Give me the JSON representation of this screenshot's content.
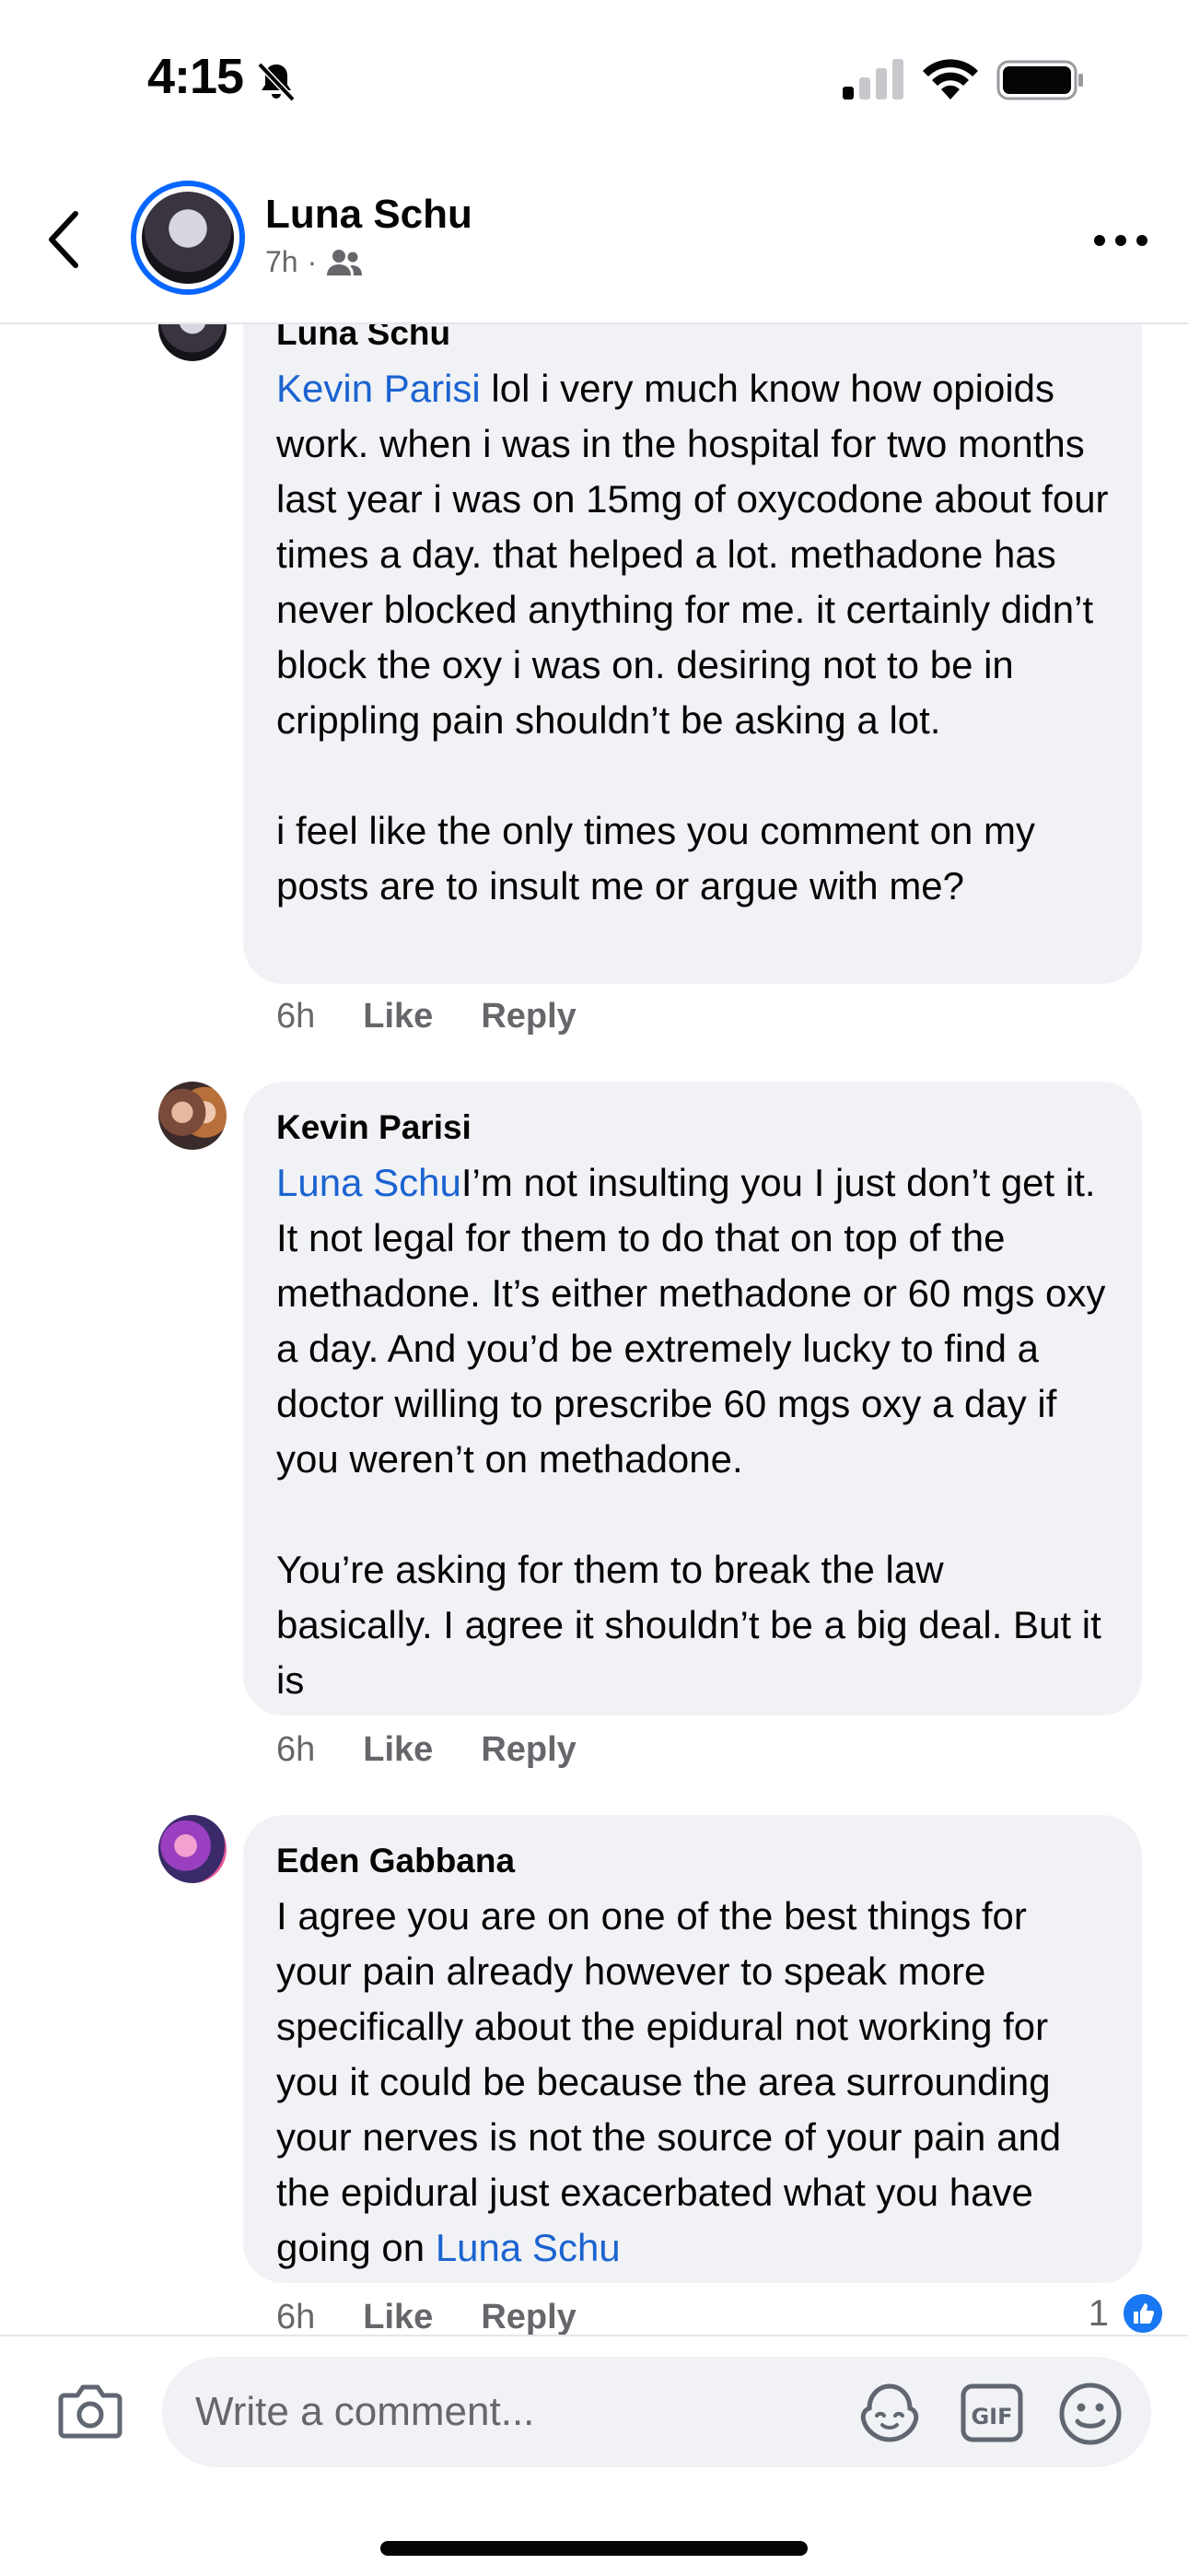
{
  "status_bar": {
    "time": "4:15"
  },
  "header": {
    "name": "Luna Schu",
    "time": "7h",
    "separator": "·"
  },
  "comments": [
    {
      "author": "Luna Schu",
      "mention": "Kevin Parisi",
      "text_after_mention": " lol i very much know how opioids work. when i was in the hospital for two months last year i was on 15mg of oxycodone about four times a day. that helped a lot. methadone has never blocked anything for me. it certainly didn’t block the oxy i was on. desiring not to be in crippling pain shouldn’t be asking a lot.\n\ni feel like the only times you comment on my posts are to insult me or argue with me?",
      "time": "6h",
      "like_label": "Like",
      "reply_label": "Reply"
    },
    {
      "author": "Kevin Parisi",
      "mention": "Luna Schu",
      "text_after_mention": "I’m not insulting you I just don’t get it. It not legal for them to do that on top of the methadone. It’s either methadone or 60 mgs oxy a day. And you’d be extremely lucky to find a doctor willing to prescribe 60 mgs oxy a day if you weren’t on methadone.\n\nYou’re asking for them to break the law basically. I agree it shouldn’t be a big deal. But it is",
      "time": "6h",
      "like_label": "Like",
      "reply_label": "Reply"
    },
    {
      "author": "Eden Gabbana",
      "text_before_mention": "I agree you are on one of the best things for your pain already however to speak more specifically about the epidural not working for you it could be because the area surrounding your nerves is not the source of your pain and the epidural just exacerbated what you have going on ",
      "mention": "Luna Schu",
      "time": "6h",
      "like_label": "Like",
      "reply_label": "Reply",
      "reaction_count": "1"
    }
  ],
  "composer": {
    "placeholder": "Write a comment..."
  },
  "colors": {
    "accent": "#0866ff",
    "mention": "#1b63d1",
    "bubble": "#f0f2f5",
    "secondary_text": "#65676b"
  }
}
